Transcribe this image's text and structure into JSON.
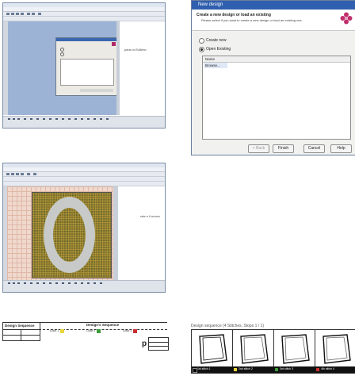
{
  "dialog": {
    "title": "New design",
    "heading": "Create a new design or load an existing",
    "subtext": "Please select if you want to create a new design or load an existing one.",
    "options": [
      {
        "label": "Create new",
        "selected": false
      },
      {
        "label": "Open Existing",
        "selected": true
      }
    ],
    "list_header": "Name",
    "list_items": [
      "Browse..."
    ],
    "buttons": {
      "back": "< Back",
      "finish": "Finish",
      "cancel": "Cancel",
      "help": "Help"
    },
    "accent_color": "#2f5fae",
    "logo_color": "#c0306e"
  },
  "shot1": {
    "inner_dialog_label": "",
    "side_text": "para ra il'Ultimo"
  },
  "shot2": {
    "side_text": "raie e il nuovo"
  },
  "doc": {
    "left_title": "Design Sequence",
    "center_title": "Design's Sequence",
    "colors": [
      {
        "label": "Color 1",
        "hex": "#e8d53a"
      },
      {
        "label": "Color 2",
        "hex": "#3a9a3a"
      },
      {
        "label": "Color 3",
        "hex": "#c83030"
      }
    ],
    "right_letter": "p"
  },
  "frames": {
    "title": "Design sequence (4 Stitches, Stops 1 / 1)",
    "captions": [
      {
        "label": "1st stitch 1",
        "hex": "#000000"
      },
      {
        "label": "2nd stitch 2",
        "hex": "#e8d53a"
      },
      {
        "label": "3rd stitch 3",
        "hex": "#3a9a3a"
      },
      {
        "label": "4th stitch 4",
        "hex": "#c83030"
      }
    ]
  }
}
